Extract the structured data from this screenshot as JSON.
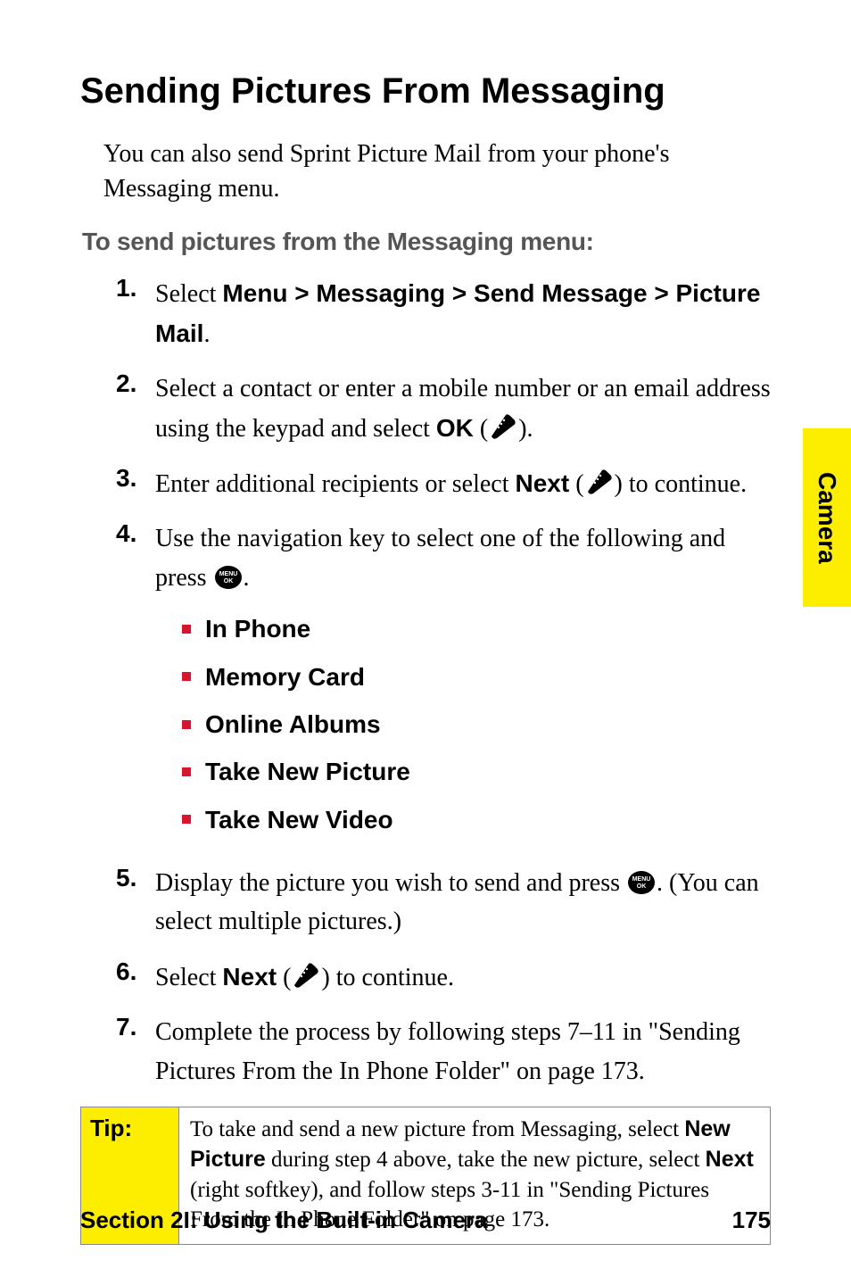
{
  "heading": "Sending Pictures From Messaging",
  "intro": "You can also send Sprint Picture Mail from your phone's Messaging menu.",
  "subhead": "To send pictures from the Messaging menu:",
  "steps": [
    {
      "num": "1.",
      "prefix": "Select ",
      "bold": "Menu > Messaging > Send Message > Picture Mail",
      "suffix": "."
    },
    {
      "num": "2.",
      "prefix": "Select a contact or enter a mobile number or an email address using the keypad and select ",
      "bold": "OK",
      "suffix_before_icon": " (",
      "icon": "phone",
      "suffix_after_icon": ")."
    },
    {
      "num": "3.",
      "prefix": "Enter additional recipients or select ",
      "bold": "Next",
      "suffix_before_icon": " (",
      "icon": "phone",
      "suffix_after_icon": ") to continue."
    },
    {
      "num": "4.",
      "prefix": "Use the navigation key to select one of the following and press ",
      "icon": "menu",
      "suffix_after_icon": ".",
      "sublist": [
        "In Phone",
        "Memory Card",
        "Online Albums",
        "Take New Picture",
        "Take New Video"
      ]
    },
    {
      "num": "5.",
      "prefix": "Display the picture you wish to send and press ",
      "icon": "menu",
      "suffix_after_icon": ". (You can select multiple pictures.)"
    },
    {
      "num": "6.",
      "prefix": "Select ",
      "bold": "Next",
      "suffix_before_icon": " (",
      "icon": "phone",
      "suffix_after_icon": ") to continue."
    },
    {
      "num": "7.",
      "prefix": "Complete the process by following steps 7–11 in \"Sending Pictures From the In Phone Folder\" on page 173."
    }
  ],
  "tip": {
    "label": "Tip:",
    "t1": "To take and send a new picture from Messaging, select ",
    "b1": "New Picture",
    "t2": " during step 4 above, take the new picture, select ",
    "b2": "Next",
    "t3": " (right softkey), and follow steps 3-11 in \"Sending Pictures From the In Phone Folder\" on page 173."
  },
  "tab": "Camera",
  "footer": {
    "left": "Section 2I: Using the Built-in Camera",
    "right": "175"
  },
  "icons": {
    "phone": "phone-icon",
    "menu": "menu-ok-icon"
  }
}
